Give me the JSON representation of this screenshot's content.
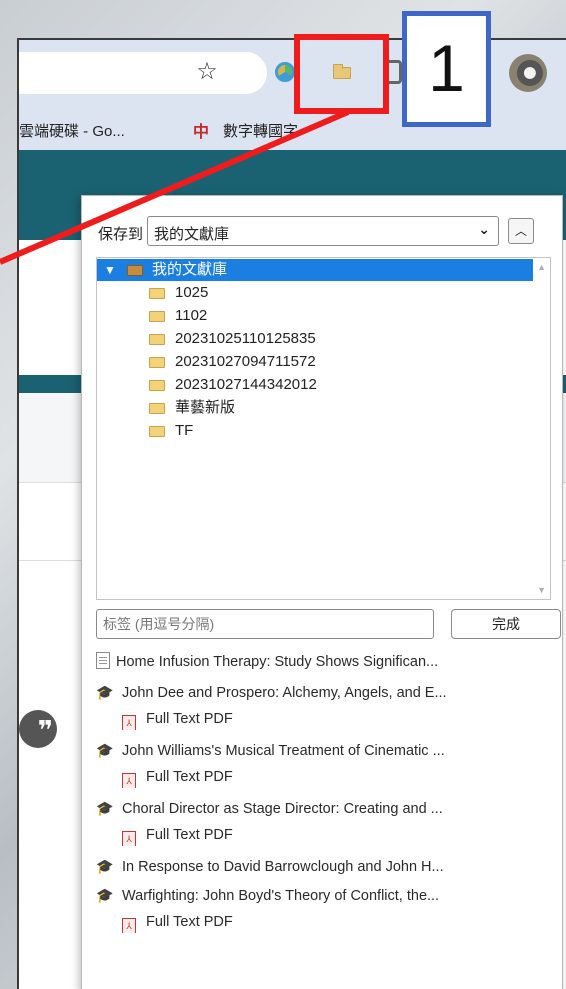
{
  "browser": {
    "bookmarks": [
      {
        "label": "雲端硬碟 - Go..."
      },
      {
        "icon": "中",
        "label": "數字轉國字"
      }
    ]
  },
  "popup": {
    "save_label": "保存到",
    "library_selected": "我的文獻庫",
    "tree": [
      {
        "label": "我的文獻庫",
        "level": 0,
        "selected": true
      },
      {
        "label": "1025",
        "level": 1
      },
      {
        "label": "1102",
        "level": 1
      },
      {
        "label": "20231025110125835",
        "level": 1
      },
      {
        "label": "20231027094711572",
        "level": 1
      },
      {
        "label": "20231027144342012",
        "level": 1
      },
      {
        "label": "華藝新版",
        "level": 1
      },
      {
        "label": "TF",
        "level": 1
      }
    ],
    "tags_placeholder": "标签 (用逗号分隔)",
    "done_label": "完成",
    "items": [
      {
        "type": "document",
        "label": "Home Infusion Therapy: Study Shows Significan..."
      },
      {
        "type": "journal",
        "label": "John Dee and Prospero: Alchemy, Angels, and E..."
      },
      {
        "type": "pdf",
        "label": "Full Text PDF"
      },
      {
        "type": "journal",
        "label": "John Williams's Musical Treatment of Cinematic ..."
      },
      {
        "type": "pdf",
        "label": "Full Text PDF"
      },
      {
        "type": "journal",
        "label": "Choral Director as Stage Director: Creating and ..."
      },
      {
        "type": "pdf",
        "label": "Full Text PDF"
      },
      {
        "type": "journal",
        "label": "In Response to David Barrowclough and John H..."
      },
      {
        "type": "journal",
        "label": "Warfighting: John Boyd's Theory of Conflict, the..."
      },
      {
        "type": "pdf",
        "label": "Full Text PDF"
      }
    ]
  },
  "annotation": {
    "number": "1",
    "red_color": "#ee1c1c",
    "blue_color": "#3d68c8"
  }
}
